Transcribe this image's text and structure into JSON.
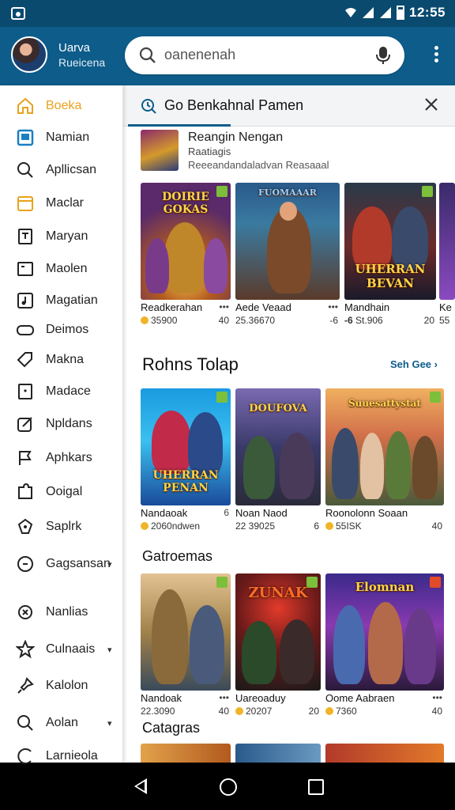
{
  "status_bar": {
    "time": "12:55"
  },
  "header": {
    "user_name": "Uarva",
    "user_sub": "Rueicena",
    "search_placeholder": "oanenenah",
    "menu_icon": "more-vert-icon"
  },
  "drawer": {
    "items": [
      {
        "label": "Boeka",
        "icon": "home-icon"
      },
      {
        "label": "Namian",
        "icon": "square-icon"
      },
      {
        "label": "Apllicsan",
        "icon": "search-icon"
      },
      {
        "label": "Maclar",
        "icon": "calendar-icon"
      },
      {
        "label": "Maryan",
        "icon": "doc-icon"
      },
      {
        "label": "Maolen",
        "icon": "window-icon"
      },
      {
        "label": "Magatian",
        "icon": "music-icon"
      },
      {
        "label": "Deimos",
        "icon": "pill-icon"
      },
      {
        "label": "Makna",
        "icon": "tag-icon"
      },
      {
        "label": "Madace",
        "icon": "box-icon"
      },
      {
        "label": "Npldans",
        "icon": "edit-icon"
      },
      {
        "label": "Aphkars",
        "icon": "flag-icon"
      },
      {
        "label": "Ooigal",
        "icon": "puzzle-icon"
      },
      {
        "label": "Saplrk",
        "icon": "gamepad-icon"
      },
      {
        "label": "Gagsansan",
        "icon": "circle-icon"
      },
      {
        "label": "Nanlias",
        "icon": "star-burst-icon"
      },
      {
        "label": "Culnaais",
        "icon": "star-icon"
      },
      {
        "label": "Kalolon",
        "icon": "pin-icon"
      },
      {
        "label": "Aolan",
        "icon": "search-icon"
      },
      {
        "label": "Larnieola",
        "icon": "circle-icon"
      }
    ]
  },
  "tab": {
    "label": "Go Benkahnal Pamen"
  },
  "feature": {
    "title": "Reangin Nengan",
    "sub1": "Raatiagis",
    "sub2": "Reeeandandaladvan Reasaaal"
  },
  "row1": [
    {
      "title": "Readkerahan",
      "meta": "35900",
      "num": "40",
      "logo": "DOIRIE GOKAS"
    },
    {
      "title": "Aede Veaad",
      "meta": "25.36670",
      "num": "-6",
      "logo": "FUOMAAAR"
    },
    {
      "title": "Mandhain",
      "meta": "St.906",
      "num": "20",
      "logo": "UHERRAN BEVAN"
    },
    {
      "title": "Ke",
      "meta": "55",
      "num": "",
      "logo": ""
    }
  ],
  "section2": {
    "title": "Rohns Tolap",
    "see_all": "Seh Gee"
  },
  "row2": [
    {
      "title": "Nandaoak",
      "meta": "2060ndwen",
      "num": "6",
      "logo": "UHERRAN PENAN"
    },
    {
      "title": "Noan Naod",
      "meta": "22 39025",
      "num": "6",
      "logo": "DOUFOVA"
    },
    {
      "title": "Roonolonn Soaan",
      "meta": "55ISK",
      "num": "40",
      "logo": "Suuesattystat"
    }
  ],
  "section3": {
    "title": "Gatroemas"
  },
  "row3": [
    {
      "title": "Nandoak",
      "meta": "22.3090",
      "num": "40",
      "logo": ""
    },
    {
      "title": "Uareoaduy",
      "meta": "20207",
      "num": "20",
      "logo": "ZUNAK"
    },
    {
      "title": "Oome Aabraen",
      "meta": "7360",
      "num": "40",
      "logo": "Elomnan"
    }
  ],
  "section4": {
    "title": "Catagras"
  }
}
